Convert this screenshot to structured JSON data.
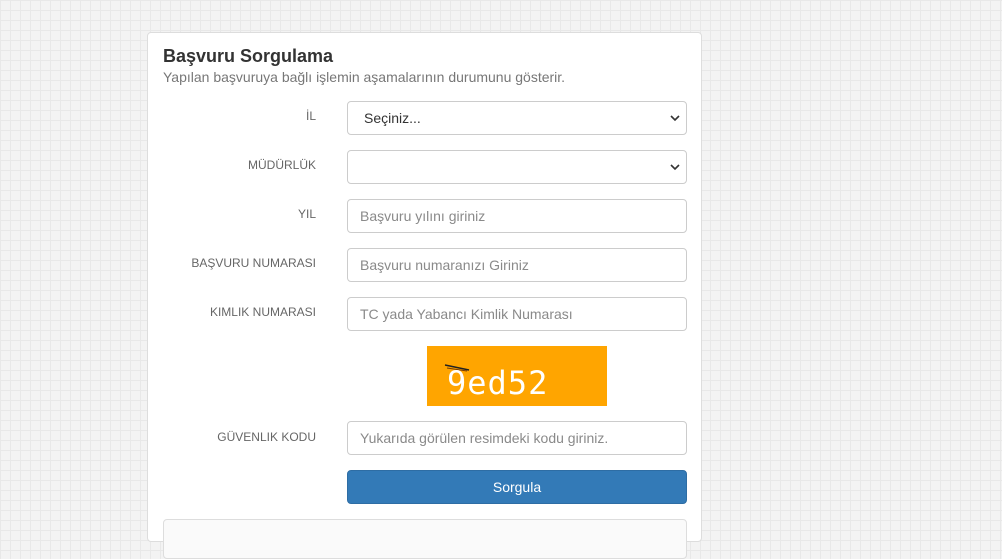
{
  "panel": {
    "title": "Başvuru Sorgulama",
    "subtitle": "Yapılan başvuruya bağlı işlemin aşamalarının durumunu gösterir."
  },
  "form": {
    "il": {
      "label": "İL",
      "selected": "Seçiniz..."
    },
    "mudurluk": {
      "label": "MÜDÜRLÜK",
      "selected": ""
    },
    "yil": {
      "label": "YIL",
      "value": "",
      "placeholder": "Başvuru yılını giriniz"
    },
    "basvuru_no": {
      "label": "BAŞVURU NUMARASI",
      "value": "",
      "placeholder": "Başvuru numaranızı Giriniz"
    },
    "kimlik_no": {
      "label": "KIMLIK NUMARASI",
      "value": "",
      "placeholder": "TC yada Yabancı Kimlik Numarası"
    },
    "captcha": {
      "text": "9ed52",
      "background_color": "#ffa500"
    },
    "guvenlik_kodu": {
      "label": "GÜVENLIK KODU",
      "value": "",
      "placeholder": "Yukarıda görülen resimdeki kodu giriniz."
    },
    "submit_label": "Sorgula"
  },
  "colors": {
    "primary": "#337ab7",
    "primary_border": "#2e6da4",
    "label": "#666666",
    "subtitle": "#777777"
  },
  "icons": {
    "select_arrow": "chevron-down-icon"
  }
}
